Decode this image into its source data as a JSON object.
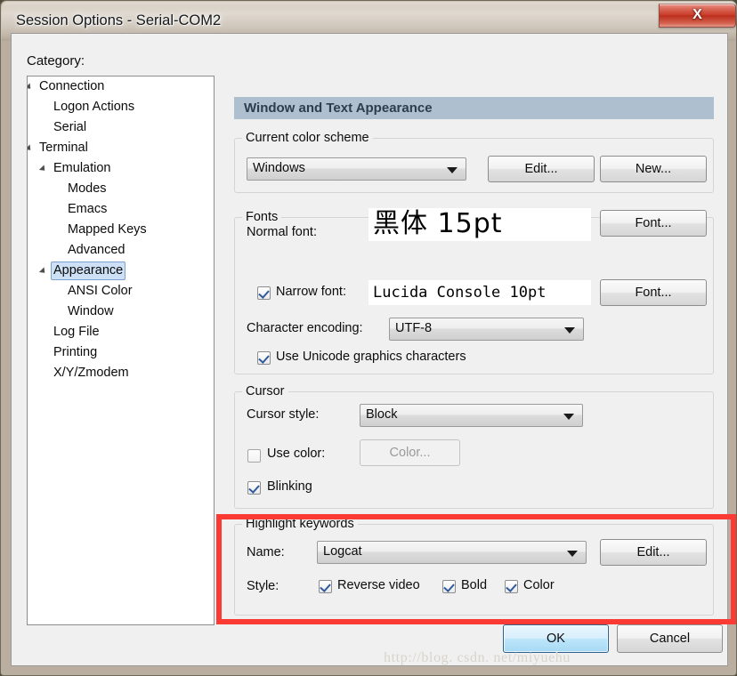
{
  "window": {
    "title": "Session Options - Serial-COM2",
    "close_icon": "close-x-icon",
    "close_label": "X"
  },
  "sidebar": {
    "label": "Category:",
    "items": [
      {
        "label": "Connection",
        "indent": 0,
        "expander": true,
        "selected": false
      },
      {
        "label": "Logon Actions",
        "indent": 1,
        "expander": false,
        "selected": false
      },
      {
        "label": "Serial",
        "indent": 1,
        "expander": false,
        "selected": false
      },
      {
        "label": "Terminal",
        "indent": 0,
        "expander": true,
        "selected": false
      },
      {
        "label": "Emulation",
        "indent": 1,
        "expander": true,
        "selected": false
      },
      {
        "label": "Modes",
        "indent": 2,
        "expander": false,
        "selected": false
      },
      {
        "label": "Emacs",
        "indent": 2,
        "expander": false,
        "selected": false
      },
      {
        "label": "Mapped Keys",
        "indent": 2,
        "expander": false,
        "selected": false
      },
      {
        "label": "Advanced",
        "indent": 2,
        "expander": false,
        "selected": false
      },
      {
        "label": "Appearance",
        "indent": 1,
        "expander": true,
        "selected": true
      },
      {
        "label": "ANSI Color",
        "indent": 2,
        "expander": false,
        "selected": false
      },
      {
        "label": "Window",
        "indent": 2,
        "expander": false,
        "selected": false
      },
      {
        "label": "Log File",
        "indent": 1,
        "expander": false,
        "selected": false
      },
      {
        "label": "Printing",
        "indent": 1,
        "expander": false,
        "selected": false
      },
      {
        "label": "X/Y/Zmodem",
        "indent": 1,
        "expander": false,
        "selected": false
      }
    ]
  },
  "pane": {
    "header": "Window and Text Appearance"
  },
  "color_scheme": {
    "group_title": "Current color scheme",
    "combo_value": "Windows",
    "edit_button": "Edit...",
    "new_button": "New..."
  },
  "fonts": {
    "group_title": "Fonts",
    "normal_font_label": "Normal font:",
    "normal_font_value": "黑体 15pt",
    "normal_font_button": "Font...",
    "narrow_font_label": "Narrow font:",
    "narrow_font_checked": true,
    "narrow_font_value": "Lucida Console 10pt",
    "narrow_font_button": "Font...",
    "encoding_label": "Character encoding:",
    "encoding_value": "UTF-8",
    "unicode_graphics_label": "Use Unicode graphics characters",
    "unicode_graphics_checked": true
  },
  "cursor": {
    "group_title": "Cursor",
    "style_label": "Cursor style:",
    "style_value": "Block",
    "use_color_label": "Use color:",
    "use_color_checked": false,
    "color_button": "Color...",
    "blinking_label": "Blinking",
    "blinking_checked": true
  },
  "highlight": {
    "group_title": "Highlight keywords",
    "name_label": "Name:",
    "name_value": "Logcat",
    "edit_button": "Edit...",
    "style_label": "Style:",
    "reverse_video_label": "Reverse video",
    "reverse_video_checked": true,
    "bold_label": "Bold",
    "bold_checked": true,
    "color_label": "Color",
    "color_checked": true,
    "annotation_color": "#fb3a33"
  },
  "footer": {
    "ok_button": "OK",
    "cancel_button": "Cancel",
    "watermark": "http://blog. csdn. net/miyuehu"
  },
  "colors": {
    "pane_header_bg": "#aebfd0",
    "dialog_bg": "#f0f0f0",
    "selection_bg": "#cde0f5",
    "close_button_red": "#c83a26"
  }
}
